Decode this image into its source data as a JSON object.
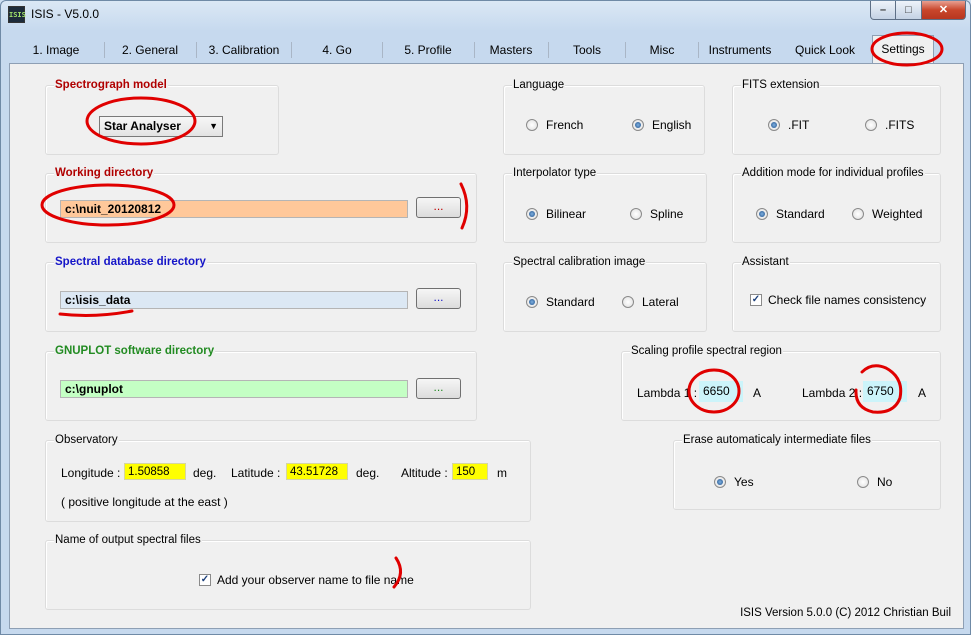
{
  "window": {
    "title": "ISIS - V5.0.0",
    "icon": "isis-app-icon",
    "icon_text": "ISIS"
  },
  "titlebar_buttons": {
    "minimize": "–",
    "maximize": "□",
    "close": "✕"
  },
  "tabs": [
    "1. Image",
    "2. General",
    "3. Calibration",
    "4. Go",
    "5. Profile",
    "Masters",
    "Tools",
    "Misc",
    "Instruments",
    "Quick Look",
    "Settings"
  ],
  "active_tab": "Settings",
  "spectrograph": {
    "title": "Spectrograph model",
    "value": "Star Analyser"
  },
  "working_dir": {
    "title": "Working directory",
    "value": "c:\\nuit_20120812",
    "button": "...",
    "color": "#ffc89a"
  },
  "spectral_db": {
    "title": "Spectral database directory",
    "value": "c:\\isis_data",
    "button": "...",
    "color": "#dce8f4"
  },
  "gnuplot": {
    "title": "GNUPLOT software directory",
    "value": "c:\\gnuplot",
    "button": "...",
    "color": "#c4ffc4"
  },
  "observatory": {
    "title": "Observatory",
    "longitude_label": "Longitude :",
    "longitude": "1.50858",
    "deg1": "deg.",
    "latitude_label": "Latitude :",
    "latitude": "43.51728",
    "deg2": "deg.",
    "altitude_label": "Altitude :",
    "altitude": "150",
    "m": "m",
    "note": "( positive longitude at the east )"
  },
  "output_files": {
    "title": "Name of output spectral files",
    "checkbox": "Add your observer name to file name",
    "checked": true
  },
  "language": {
    "title": "Language",
    "options": [
      "French",
      "English"
    ],
    "selected": "English"
  },
  "fits_ext": {
    "title": "FITS extension",
    "options": [
      ".FIT",
      ".FITS"
    ],
    "selected": ".FIT"
  },
  "interpolator": {
    "title": "Interpolator type",
    "options": [
      "Bilinear",
      "Spline"
    ],
    "selected": "Bilinear"
  },
  "addition_mode": {
    "title": "Addition mode for individual profiles",
    "options": [
      "Standard",
      "Weighted"
    ],
    "selected": "Standard"
  },
  "calib_image": {
    "title": "Spectral calibration image",
    "options": [
      "Standard",
      "Lateral"
    ],
    "selected": "Standard"
  },
  "assistant": {
    "title": "Assistant",
    "checkbox": "Check file names consistency",
    "checked": true
  },
  "scaling": {
    "title": "Scaling profile spectral region",
    "lambda1_label": "Lambda 1 :",
    "lambda1": "6650",
    "unit1": "A",
    "lambda2_label": "Lambda 2 :",
    "lambda2": "6750",
    "unit2": "A"
  },
  "erase": {
    "title": "Erase automaticaly intermediate files",
    "options": [
      "Yes",
      "No"
    ],
    "selected": "Yes"
  },
  "version": "ISIS Version 5.0.0 (C) 2012 Christian Buil",
  "colors": {
    "annotation": "#e00000",
    "highlight_yellow": "#ffff00",
    "lambda_bg": "#ccf4fa"
  }
}
